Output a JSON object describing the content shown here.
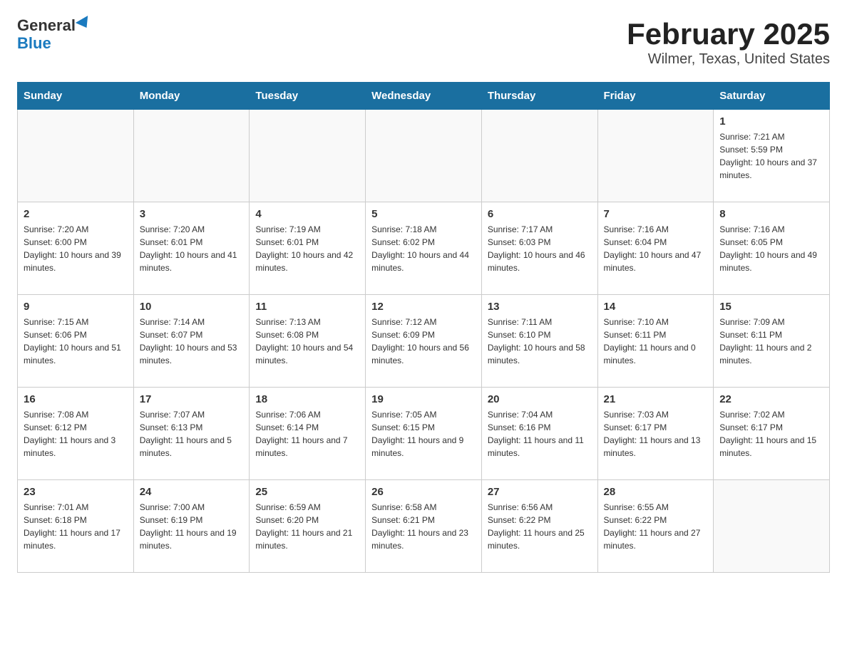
{
  "logo": {
    "general": "General",
    "blue": "Blue"
  },
  "title": "February 2025",
  "subtitle": "Wilmer, Texas, United States",
  "days_of_week": [
    "Sunday",
    "Monday",
    "Tuesday",
    "Wednesday",
    "Thursday",
    "Friday",
    "Saturday"
  ],
  "weeks": [
    [
      {
        "day": "",
        "info": ""
      },
      {
        "day": "",
        "info": ""
      },
      {
        "day": "",
        "info": ""
      },
      {
        "day": "",
        "info": ""
      },
      {
        "day": "",
        "info": ""
      },
      {
        "day": "",
        "info": ""
      },
      {
        "day": "1",
        "info": "Sunrise: 7:21 AM\nSunset: 5:59 PM\nDaylight: 10 hours and 37 minutes."
      }
    ],
    [
      {
        "day": "2",
        "info": "Sunrise: 7:20 AM\nSunset: 6:00 PM\nDaylight: 10 hours and 39 minutes."
      },
      {
        "day": "3",
        "info": "Sunrise: 7:20 AM\nSunset: 6:01 PM\nDaylight: 10 hours and 41 minutes."
      },
      {
        "day": "4",
        "info": "Sunrise: 7:19 AM\nSunset: 6:01 PM\nDaylight: 10 hours and 42 minutes."
      },
      {
        "day": "5",
        "info": "Sunrise: 7:18 AM\nSunset: 6:02 PM\nDaylight: 10 hours and 44 minutes."
      },
      {
        "day": "6",
        "info": "Sunrise: 7:17 AM\nSunset: 6:03 PM\nDaylight: 10 hours and 46 minutes."
      },
      {
        "day": "7",
        "info": "Sunrise: 7:16 AM\nSunset: 6:04 PM\nDaylight: 10 hours and 47 minutes."
      },
      {
        "day": "8",
        "info": "Sunrise: 7:16 AM\nSunset: 6:05 PM\nDaylight: 10 hours and 49 minutes."
      }
    ],
    [
      {
        "day": "9",
        "info": "Sunrise: 7:15 AM\nSunset: 6:06 PM\nDaylight: 10 hours and 51 minutes."
      },
      {
        "day": "10",
        "info": "Sunrise: 7:14 AM\nSunset: 6:07 PM\nDaylight: 10 hours and 53 minutes."
      },
      {
        "day": "11",
        "info": "Sunrise: 7:13 AM\nSunset: 6:08 PM\nDaylight: 10 hours and 54 minutes."
      },
      {
        "day": "12",
        "info": "Sunrise: 7:12 AM\nSunset: 6:09 PM\nDaylight: 10 hours and 56 minutes."
      },
      {
        "day": "13",
        "info": "Sunrise: 7:11 AM\nSunset: 6:10 PM\nDaylight: 10 hours and 58 minutes."
      },
      {
        "day": "14",
        "info": "Sunrise: 7:10 AM\nSunset: 6:11 PM\nDaylight: 11 hours and 0 minutes."
      },
      {
        "day": "15",
        "info": "Sunrise: 7:09 AM\nSunset: 6:11 PM\nDaylight: 11 hours and 2 minutes."
      }
    ],
    [
      {
        "day": "16",
        "info": "Sunrise: 7:08 AM\nSunset: 6:12 PM\nDaylight: 11 hours and 3 minutes."
      },
      {
        "day": "17",
        "info": "Sunrise: 7:07 AM\nSunset: 6:13 PM\nDaylight: 11 hours and 5 minutes."
      },
      {
        "day": "18",
        "info": "Sunrise: 7:06 AM\nSunset: 6:14 PM\nDaylight: 11 hours and 7 minutes."
      },
      {
        "day": "19",
        "info": "Sunrise: 7:05 AM\nSunset: 6:15 PM\nDaylight: 11 hours and 9 minutes."
      },
      {
        "day": "20",
        "info": "Sunrise: 7:04 AM\nSunset: 6:16 PM\nDaylight: 11 hours and 11 minutes."
      },
      {
        "day": "21",
        "info": "Sunrise: 7:03 AM\nSunset: 6:17 PM\nDaylight: 11 hours and 13 minutes."
      },
      {
        "day": "22",
        "info": "Sunrise: 7:02 AM\nSunset: 6:17 PM\nDaylight: 11 hours and 15 minutes."
      }
    ],
    [
      {
        "day": "23",
        "info": "Sunrise: 7:01 AM\nSunset: 6:18 PM\nDaylight: 11 hours and 17 minutes."
      },
      {
        "day": "24",
        "info": "Sunrise: 7:00 AM\nSunset: 6:19 PM\nDaylight: 11 hours and 19 minutes."
      },
      {
        "day": "25",
        "info": "Sunrise: 6:59 AM\nSunset: 6:20 PM\nDaylight: 11 hours and 21 minutes."
      },
      {
        "day": "26",
        "info": "Sunrise: 6:58 AM\nSunset: 6:21 PM\nDaylight: 11 hours and 23 minutes."
      },
      {
        "day": "27",
        "info": "Sunrise: 6:56 AM\nSunset: 6:22 PM\nDaylight: 11 hours and 25 minutes."
      },
      {
        "day": "28",
        "info": "Sunrise: 6:55 AM\nSunset: 6:22 PM\nDaylight: 11 hours and 27 minutes."
      },
      {
        "day": "",
        "info": ""
      }
    ]
  ]
}
